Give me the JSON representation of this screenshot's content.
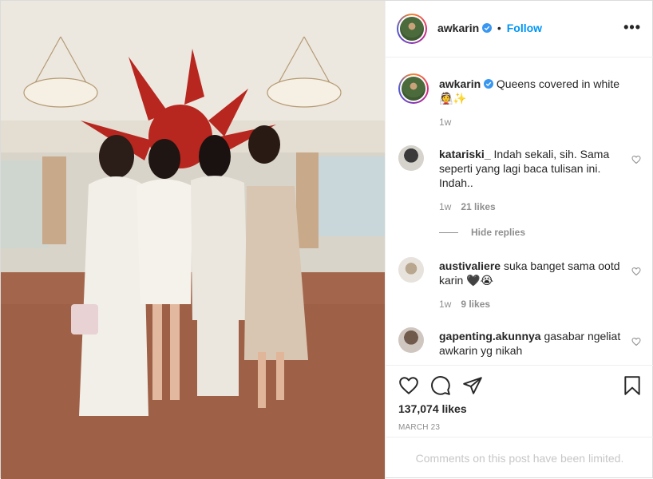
{
  "post": {
    "author": "awkarin",
    "follow_label": "Follow",
    "separator": "•",
    "more_label": "•••",
    "caption": {
      "username": "awkarin",
      "text": "Queens covered in white",
      "emoji": "👰✨",
      "time": "1w"
    },
    "comments": [
      {
        "username": "katariski_",
        "text": "Indah sekali, sih. Sama seperti yang lagi baca tulisan ini. Indah..",
        "time": "1w",
        "likes": "21 likes"
      },
      {
        "username": "austivaliere",
        "text": "suka banget sama ootd karin 🖤😭",
        "time": "1w",
        "likes": "9 likes"
      },
      {
        "username": "gapenting.akunnya",
        "text": "gasabar ngeliat awkarin yg nikah"
      }
    ],
    "hide_replies_label": "Hide replies",
    "likes_count": "137,074 likes",
    "date": "MARCH 23",
    "comments_limited": "Comments on this post have been limited."
  },
  "icons": {
    "verified": "verified-badge-icon",
    "like": "heart-icon",
    "comment": "comment-icon",
    "share": "paper-plane-icon",
    "save": "bookmark-icon"
  },
  "colors": {
    "accent": "#0095f6",
    "muted": "#8e8e8e",
    "limited_text": "#c7c7c7"
  }
}
